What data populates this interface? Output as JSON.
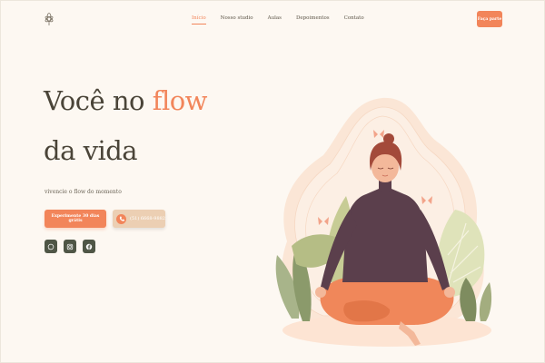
{
  "header": {
    "logo_icon": "lotus-icon",
    "nav": [
      {
        "label": "Início",
        "active": true
      },
      {
        "label": "Nosso studio",
        "active": false
      },
      {
        "label": "Aulas",
        "active": false
      },
      {
        "label": "Depoimentos",
        "active": false
      },
      {
        "label": "Contato",
        "active": false
      }
    ],
    "cta_label": "Faça parte"
  },
  "hero": {
    "line1_prefix": "Você no ",
    "line1_highlight": "flow",
    "line2": "da vida",
    "subtitle": "vivencie o flow do momento",
    "trial_button": "Experimente 30 dias grátis",
    "phone_button": "(51) 6668-9882",
    "phone_icon": "phone-icon"
  },
  "socials": [
    {
      "icon": "whatsapp-icon"
    },
    {
      "icon": "instagram-icon"
    },
    {
      "icon": "facebook-icon"
    }
  ],
  "colors": {
    "background": "#fdf8f2",
    "accent": "#f2855a",
    "text": "#4a4438",
    "social_bg": "#4f5646",
    "phone_button_bg": "#eccfb3"
  }
}
